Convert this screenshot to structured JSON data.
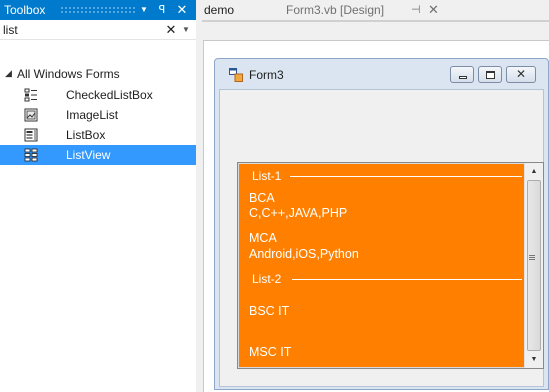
{
  "toolbox": {
    "title": "Toolbox",
    "header_icons": [
      "dropdown-arrow-icon",
      "pin-icon",
      "close-icon"
    ],
    "search": {
      "value": "list",
      "clear_glyph": "✕"
    },
    "group": {
      "label": "All Windows Forms",
      "expanded": true
    },
    "items": [
      {
        "label": "CheckedListBox",
        "icon": "checkedlistbox-icon",
        "selected": false
      },
      {
        "label": "ImageList",
        "icon": "imagelist-icon",
        "selected": false
      },
      {
        "label": "ListBox",
        "icon": "listbox-icon",
        "selected": false
      },
      {
        "label": "ListView",
        "icon": "listview-icon",
        "selected": true
      }
    ],
    "selected_color": "#3399ff",
    "title_color": "#007acc"
  },
  "tabs": [
    {
      "label": "demo",
      "active": false
    },
    {
      "label": "Form3.vb [Design]",
      "active": true
    }
  ],
  "form": {
    "title": "Form3",
    "caption_buttons": [
      "minimize-icon",
      "maximize-icon",
      "close-icon"
    ]
  },
  "listview": {
    "background": "#ff8000",
    "groups": [
      {
        "header": "List-1",
        "items": [
          {
            "text": "BCA",
            "subtext": "C,C++,JAVA,PHP"
          },
          {
            "text": "MCA",
            "subtext": "Android,iOS,Python"
          }
        ]
      },
      {
        "header": "List-2",
        "items": [
          {
            "text": "BSC IT"
          },
          {
            "text": "MSC IT"
          }
        ]
      }
    ]
  }
}
